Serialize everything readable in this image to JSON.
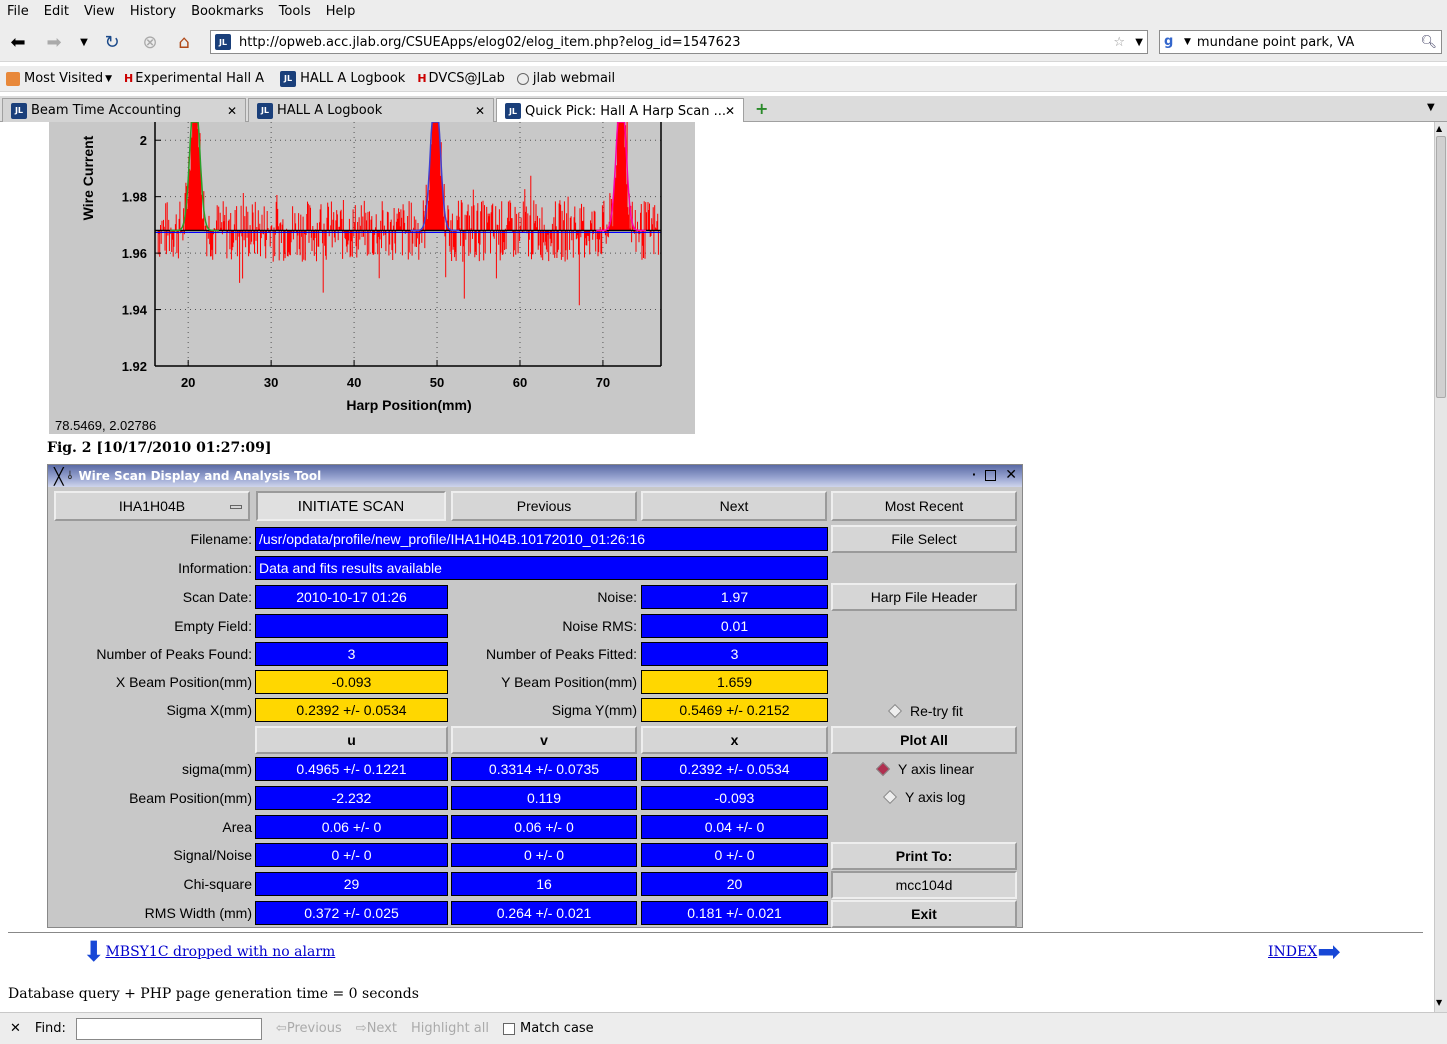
{
  "menu": [
    "File",
    "Edit",
    "View",
    "History",
    "Bookmarks",
    "Tools",
    "Help"
  ],
  "url": "http://opweb.acc.jlab.org/CSUEApps/elog02/elog_item.php?elog_id=1547623",
  "search_value": "mundane point park, VA",
  "bookmarks": [
    "Most Visited",
    "Experimental Hall A",
    "HALL A Logbook",
    "DVCS@JLab",
    "jlab webmail"
  ],
  "tabs": [
    "Beam Time Accounting",
    "HALL A Logbook",
    "Quick Pick: Hall A Harp Scan ..."
  ],
  "chart_data": {
    "type": "line",
    "xlabel": "Harp Position(mm)",
    "ylabel": "Wire Current",
    "xticks": [
      20,
      30,
      40,
      50,
      60,
      70
    ],
    "yticks": [
      1.92,
      1.94,
      1.96,
      1.98,
      2
    ],
    "xlim": [
      16,
      77
    ],
    "ylim": [
      1.92,
      2.01
    ],
    "baseline": 1.968,
    "peaks": [
      {
        "center": 20.8,
        "height": 2.02
      },
      {
        "center": 49.8,
        "height": 2.02
      },
      {
        "center": 72.2,
        "height": 2.02
      }
    ],
    "cursor_readout": "78.5469,  2.02786"
  },
  "fig_caption": "Fig. 2 [10/17/2010 01:27:09]",
  "tool": {
    "title": "Wire Scan Display and Analysis Tool",
    "device": "IHA1H04B",
    "initiate": "INITIATE SCAN",
    "previous": "Previous",
    "next": "Next",
    "most_recent": "Most Recent",
    "filename_label": "Filename:",
    "filename": "/usr/opdata/profile/new_profile/IHA1H04B.10172010_01:26:16",
    "file_select": "File Select",
    "information_label": "Information:",
    "information": "Data and fits results available",
    "scan_date_label": "Scan Date:",
    "scan_date": "2010-10-17   01:26",
    "noise_label": "Noise:",
    "noise": "1.97",
    "harp_header": "Harp File Header",
    "empty_field_label": "Empty Field:",
    "noise_rms_label": "Noise RMS:",
    "noise_rms": "0.01",
    "peaks_found_label": "Number of Peaks Found:",
    "peaks_found": "3",
    "peaks_fitted_label": "Number of Peaks Fitted:",
    "peaks_fitted": "3",
    "xbeam_label": "X Beam Position(mm)",
    "xbeam": "-0.093",
    "ybeam_label": "Y Beam Position(mm)",
    "ybeam": "1.659",
    "sigx_label": "Sigma X(mm)",
    "sigx": "0.2392 +/- 0.0534",
    "sigy_label": "Sigma Y(mm)",
    "sigy": "0.5469 +/- 0.2152",
    "retry": "Re-try fit",
    "col_u": "u",
    "col_v": "v",
    "col_x": "x",
    "plot_all": "Plot All",
    "y_linear": "Y axis linear",
    "y_log": "Y axis log",
    "rows": [
      {
        "label": "sigma(mm)",
        "u": "0.4965 +/- 0.1221",
        "v": "0.3314 +/- 0.0735",
        "x": "0.2392 +/- 0.0534"
      },
      {
        "label": "Beam Position(mm)",
        "u": "-2.232",
        "v": "0.119",
        "x": "-0.093"
      },
      {
        "label": "Area",
        "u": "0.06 +/- 0",
        "v": "0.06 +/- 0",
        "x": "0.04 +/- 0"
      },
      {
        "label": "Signal/Noise",
        "u": "0 +/- 0",
        "v": "0 +/- 0",
        "x": "0 +/- 0"
      },
      {
        "label": "Chi-square",
        "u": "29",
        "v": "16",
        "x": "20"
      },
      {
        "label": "RMS Width (mm)",
        "u": "0.372 +/- 0.025",
        "v": "0.264 +/- 0.021",
        "x": "0.181 +/- 0.021"
      }
    ],
    "print_to": "Print To:",
    "printer": "mcc104d",
    "exit": "Exit"
  },
  "prev_link": "MBSY1C dropped with no alarm",
  "index_link": "INDEX",
  "gen_time": "Database query + PHP page generation time = 0 seconds",
  "find": {
    "label": "Find:",
    "previous": "Previous",
    "next": "Next",
    "highlight": "Highlight all",
    "match": "Match case"
  }
}
